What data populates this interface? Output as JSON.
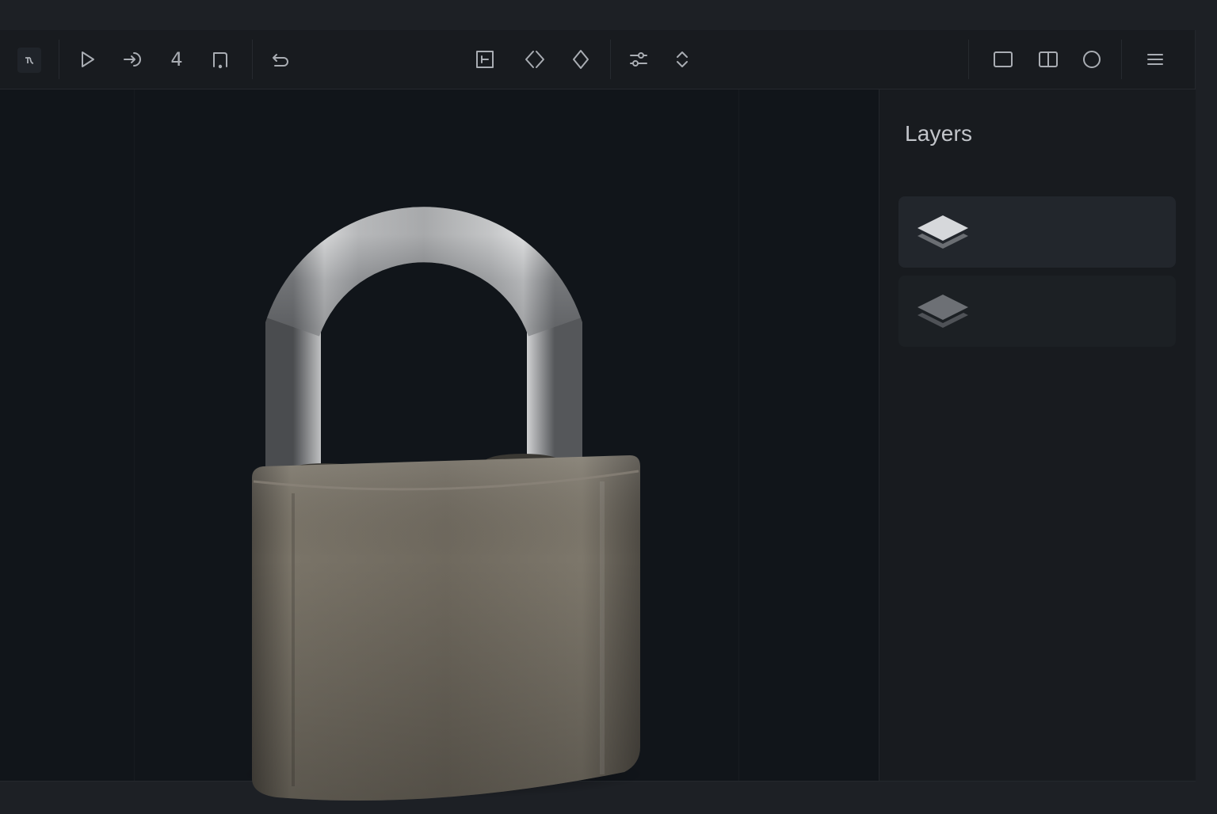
{
  "toolbar": {
    "left_tools": [
      {
        "icon": "mode-icon"
      },
      {
        "icon": "play-icon"
      },
      {
        "icon": "arrow-into-icon"
      },
      {
        "icon": "number-four-icon",
        "label": "4"
      },
      {
        "icon": "crop-frame-icon"
      },
      {
        "icon": "undo-icon"
      }
    ],
    "center_tools": [
      {
        "icon": "align-box-icon"
      },
      {
        "icon": "diamond-split-icon"
      },
      {
        "icon": "diamond-icon"
      },
      {
        "icon": "sliders-icon"
      },
      {
        "icon": "sort-arrows-icon"
      }
    ],
    "right_tools": [
      {
        "icon": "single-view-icon"
      },
      {
        "icon": "split-view-icon"
      },
      {
        "icon": "circle-icon"
      },
      {
        "icon": "menu-icon"
      }
    ]
  },
  "panel": {
    "title": "Layers",
    "layers": [
      {
        "icon": "layer-stack-icon",
        "state": "active"
      },
      {
        "icon": "layer-stack-icon",
        "state": "inactive"
      }
    ]
  },
  "colors": {
    "background": "#131619",
    "toolbar": "#181b1f",
    "icon": "#a9adb3",
    "lock_body": "#6d675c",
    "shackle": "#b8b9ba"
  }
}
